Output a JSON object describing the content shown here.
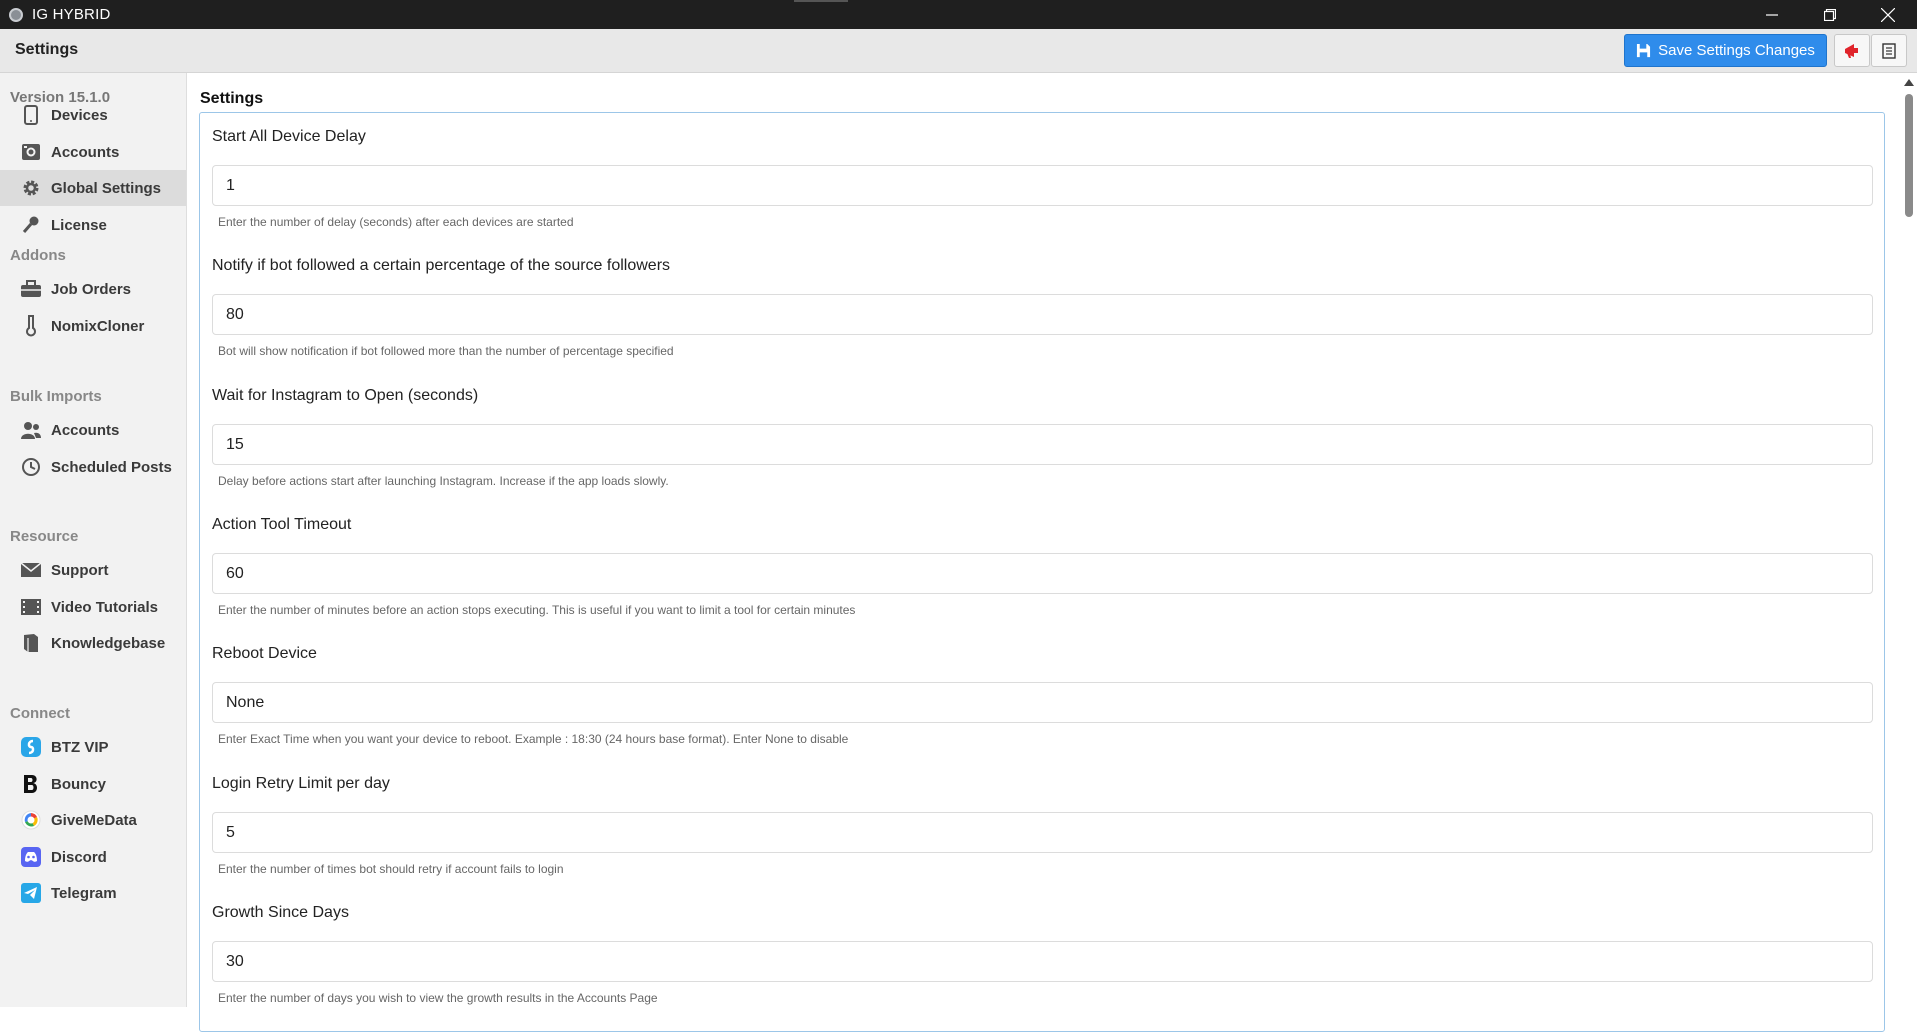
{
  "window": {
    "title": "IG HYBRID"
  },
  "header": {
    "title": "Settings",
    "save_label": "Save Settings Changes"
  },
  "sidebar": {
    "version": "Version 15.1.0",
    "nav": [
      {
        "label": "Devices",
        "icon": "phone-icon"
      },
      {
        "label": "Accounts",
        "icon": "instagram-icon"
      },
      {
        "label": "Global Settings",
        "icon": "gear-icon",
        "active": true
      },
      {
        "label": "License",
        "icon": "key-icon"
      }
    ],
    "addons_title": "Addons",
    "addons": [
      {
        "label": "Job Orders",
        "icon": "briefcase-icon"
      },
      {
        "label": "NomixCloner",
        "icon": "flask-icon"
      }
    ],
    "bulk_title": "Bulk Imports",
    "bulk": [
      {
        "label": "Accounts",
        "icon": "users-icon"
      },
      {
        "label": "Scheduled Posts",
        "icon": "clock-icon"
      }
    ],
    "resource_title": "Resource",
    "resource": [
      {
        "label": "Support",
        "icon": "envelope-icon"
      },
      {
        "label": "Video Tutorials",
        "icon": "film-icon"
      },
      {
        "label": "Knowledgebase",
        "icon": "book-icon"
      }
    ],
    "connect_title": "Connect",
    "connect": [
      {
        "label": "BTZ VIP",
        "icon": "btz-icon"
      },
      {
        "label": "Bouncy",
        "icon": "bouncy-icon"
      },
      {
        "label": "GiveMeData",
        "icon": "givemedata-icon"
      },
      {
        "label": "Discord",
        "icon": "discord-icon"
      },
      {
        "label": "Telegram",
        "icon": "telegram-icon"
      }
    ]
  },
  "main": {
    "section_title": "Settings",
    "fields": [
      {
        "label": "Start All Device Delay",
        "value": "1",
        "help": "Enter the number of delay (seconds) after each devices are started"
      },
      {
        "label": "Notify if bot followed a certain percentage of the source followers",
        "value": "80",
        "help": "Bot will show notification if bot followed more than the number of percentage specified"
      },
      {
        "label": "Wait for Instagram to Open (seconds)",
        "value": "15",
        "help": "Delay before actions start after launching Instagram. Increase if the app loads slowly."
      },
      {
        "label": "Action Tool Timeout",
        "value": "60",
        "help": "Enter the number of minutes before an action stops executing. This is useful if you want to limit a tool for certain minutes"
      },
      {
        "label": "Reboot Device",
        "value": "None",
        "help": "Enter Exact Time when you want your device to reboot. Example : 18:30 (24 hours base format). Enter None to disable"
      },
      {
        "label": "Login Retry Limit per day",
        "value": "5",
        "help": "Enter the number of times bot should retry if account fails to login"
      },
      {
        "label": "Growth Since Days",
        "value": "30",
        "help": "Enter the number of days you wish to view the growth results in the Accounts Page"
      }
    ]
  },
  "colors": {
    "accent": "#2f8ceb",
    "active_nav": "#dcdcdc",
    "box_border": "#9cc6e8"
  }
}
